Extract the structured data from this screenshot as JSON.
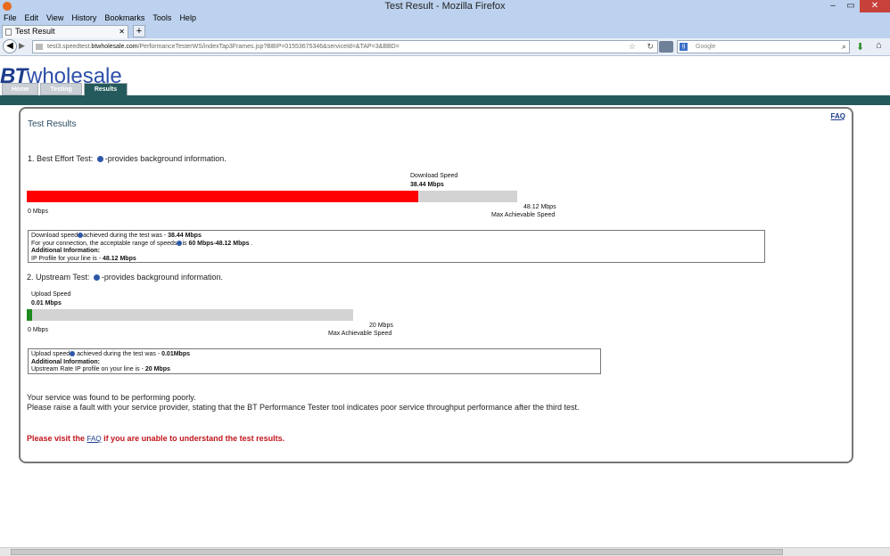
{
  "window": {
    "title": "Test Result - Mozilla Firefox",
    "min": "–",
    "max": "▭",
    "close": "✕"
  },
  "menu": [
    "File",
    "Edit",
    "View",
    "History",
    "Bookmarks",
    "Tools",
    "Help"
  ],
  "tab": {
    "label": "Test Result",
    "close": "✕",
    "new": "+"
  },
  "nav": {
    "url_pre": "test3.speedtest.",
    "url_domain": "btwholesale.com",
    "url_post": "/PerformanceTesterWS/indexTap3Frames.jsp?BBIP=01553675346&serviceId=&TAP=3&BBD=",
    "search_placeholder": "Google"
  },
  "brand": {
    "bt": "BT",
    "wholesale": "wholesale"
  },
  "site_tabs": [
    "Home",
    "Testing",
    "Results"
  ],
  "panel": {
    "title": "Test Results",
    "faq": "FAQ",
    "test1": {
      "heading": "1. Best Effort Test:",
      "suffix": "-provides background information.",
      "speed_label": "Download Speed",
      "speed_value": "38.44 Mbps",
      "min_label": "0 Mbps",
      "max_value": "48.12 Mbps",
      "max_label": "Max Achievable Speed",
      "fraction": 0.7988,
      "bar_color": "#ff0000",
      "box_line1_pre": "Download speed",
      "box_line1_mid": "achieved during the test was - ",
      "box_line1_val": "38.44 Mbps",
      "box_line2_pre": "For your connection, the acceptable range of speeds",
      "box_line2_mid": "is ",
      "box_line2_val": "60 Mbps-48.12 Mbps",
      "box_line2_end": " .",
      "box_line3": "Additional Information:",
      "box_line4_pre": "IP Profile for your line is - ",
      "box_line4_val": "48.12 Mbps"
    },
    "test2": {
      "heading": "2. Upstream Test:",
      "suffix": "-provides background information.",
      "speed_label": "Upload Speed",
      "speed_value": "0.01 Mbps",
      "min_label": "0 Mbps",
      "max_value": "20 Mbps",
      "max_label": "Max Achievable Speed",
      "fraction": 0.0005,
      "bar_color": "#1f8a1f",
      "box_line1_pre": "Upload speed",
      "box_line1_mid": " achieved during the test was - ",
      "box_line1_val": "0.01Mbps",
      "box_line2": "Additional Information:",
      "box_line3_pre": "Upstream Rate IP profile on your line is - ",
      "box_line3_val": "20 Mbps"
    },
    "message_line1": "Your service was found to be performing poorly.",
    "message_line2": "Please raise a fault with your service provider, stating that the BT Performance Tester tool indicates poor service throughput performance after the third test.",
    "warn_pre": "Please visit the ",
    "warn_link": "FAQ",
    "warn_post": " if you are unable to understand the test results."
  }
}
